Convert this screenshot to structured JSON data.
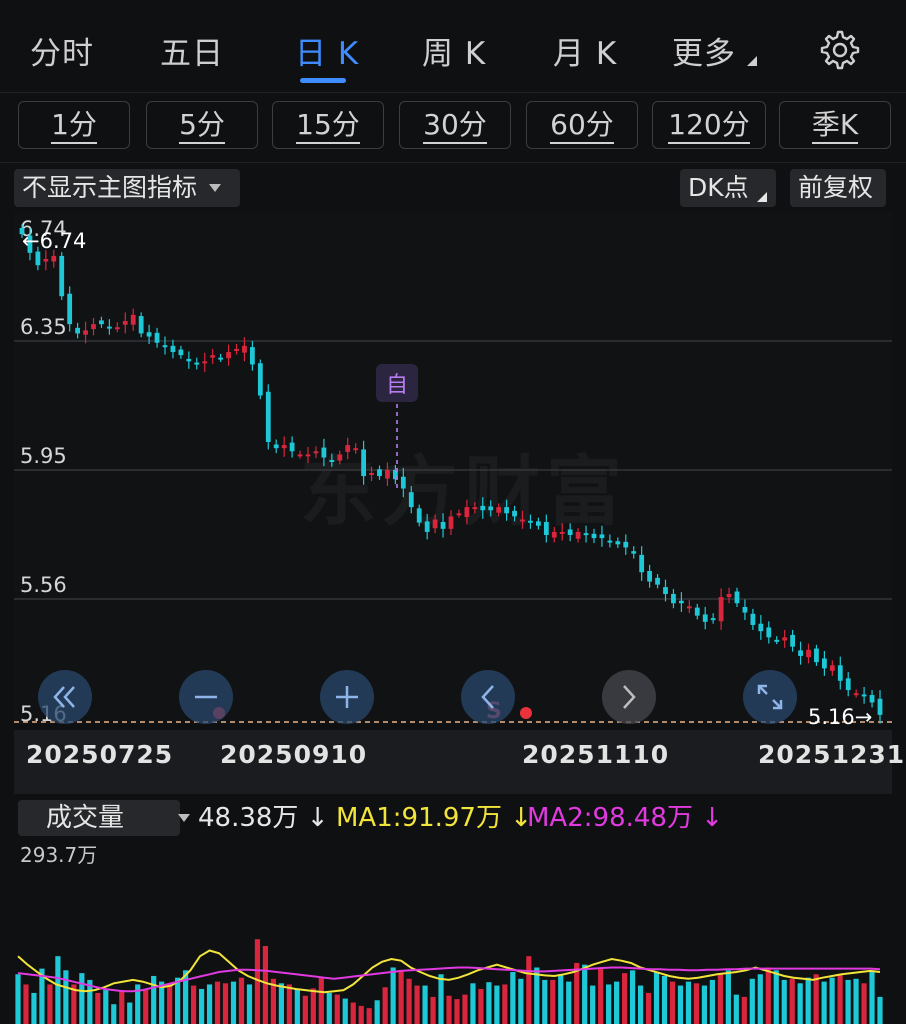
{
  "tabs": [
    {
      "label": "分时",
      "active": false
    },
    {
      "label": "五日",
      "active": false
    },
    {
      "label": "日 K",
      "active": true
    },
    {
      "label": "周 K",
      "active": false
    },
    {
      "label": "月 K",
      "active": false
    },
    {
      "label": "更多",
      "active": false
    }
  ],
  "settings_icon": "gear-icon",
  "periods": [
    "1分",
    "5分",
    "15分",
    "30分",
    "60分",
    "120分",
    "季K"
  ],
  "toolbar": {
    "indicator_select": "不显示主图指标",
    "dk_point": "DK点",
    "adjust": "前复权"
  },
  "watermark": "东方财富",
  "nav_buttons": [
    {
      "icon": "double-chevron-left-icon"
    },
    {
      "icon": "zoom-out-minus-icon"
    },
    {
      "icon": "zoom-in-plus-icon"
    },
    {
      "icon": "chevron-left-icon"
    },
    {
      "icon": "chevron-right-icon"
    },
    {
      "icon": "fullscreen-expand-icon"
    }
  ],
  "markers": {
    "self_select": "自",
    "sell": "S"
  },
  "colors": {
    "up": "#d7263d",
    "down": "#1fc8d6",
    "ma1": "#f2e43a",
    "ma2": "#e03ae0",
    "accent": "#3f8cff",
    "dash": "#e8b48a"
  },
  "chart_data": {
    "type": "candlestick",
    "price_axis": {
      "ticks": [
        "6.74",
        "6.35",
        "5.95",
        "5.56",
        "5.16"
      ],
      "ylim": [
        5.16,
        6.74
      ]
    },
    "high_label": "6.74",
    "low_label": "5.16",
    "date_labels": [
      "20250725",
      "20250910",
      "20251110",
      "20251231"
    ],
    "series": [
      {
        "name": "close",
        "values": [
          6.72,
          6.66,
          6.62,
          6.64,
          6.65,
          6.52,
          6.43,
          6.4,
          6.41,
          6.43,
          6.43,
          6.42,
          6.42,
          6.44,
          6.46,
          6.4,
          6.39,
          6.37,
          6.36,
          6.34,
          6.33,
          6.31,
          6.3,
          6.31,
          6.33,
          6.32,
          6.34,
          6.35,
          6.36,
          6.3,
          6.2,
          6.05,
          6.03,
          6.04,
          6.02,
          6.01,
          6.01,
          6.02,
          6.0,
          5.99,
          6.01,
          6.04,
          6.03,
          5.94,
          5.95,
          5.94,
          5.96,
          5.93,
          5.9,
          5.84,
          5.79,
          5.76,
          5.8,
          5.77,
          5.81,
          5.82,
          5.84,
          5.84,
          5.83,
          5.83,
          5.84,
          5.82,
          5.81,
          5.8,
          5.79,
          5.78,
          5.75,
          5.76,
          5.76,
          5.75,
          5.76,
          5.75,
          5.74,
          5.74,
          5.73,
          5.72,
          5.71,
          5.69,
          5.63,
          5.6,
          5.59,
          5.56,
          5.53,
          5.53,
          5.52,
          5.49,
          5.47,
          5.48,
          5.55,
          5.56,
          5.53,
          5.5,
          5.46,
          5.44,
          5.42,
          5.41,
          5.42,
          5.39,
          5.36,
          5.38,
          5.34,
          5.32,
          5.33,
          5.28,
          5.25,
          5.24,
          5.23,
          5.21,
          5.17
        ]
      }
    ]
  },
  "volume": {
    "indicator": "成交量",
    "current": "48.38万",
    "ma1": "MA1:91.97万",
    "ma2": "MA2:98.48万",
    "arrow": "↓",
    "axis_max": "293.7万",
    "chart_data": {
      "type": "bar",
      "ylim": [
        0,
        293.7
      ],
      "values": [
        88,
        70,
        55,
        98,
        70,
        120,
        95,
        70,
        90,
        78,
        55,
        60,
        35,
        60,
        38,
        70,
        62,
        85,
        75,
        70,
        82,
        95,
        68,
        62,
        70,
        75,
        72,
        75,
        82,
        70,
        150,
        138,
        80,
        72,
        70,
        62,
        50,
        63,
        82,
        55,
        52,
        45,
        38,
        32,
        28,
        42,
        65,
        100,
        95,
        80,
        68,
        68,
        48,
        88,
        50,
        44,
        52,
        72,
        62,
        74,
        68,
        70,
        92,
        80,
        120,
        100,
        78,
        78,
        88,
        75,
        108,
        105,
        68,
        100,
        70,
        75,
        90,
        95,
        68,
        55,
        92,
        85,
        75,
        68,
        75,
        72,
        68,
        78,
        88,
        95,
        52,
        48,
        80,
        88,
        100,
        95,
        78,
        80,
        72,
        82,
        88,
        75,
        82,
        88,
        78,
        80,
        72,
        92,
        48
      ],
      "ma1": [
        120,
        105,
        92,
        80,
        70,
        65,
        60,
        58,
        60,
        65,
        72,
        75,
        78,
        75,
        70,
        65,
        68,
        78,
        95,
        120,
        130,
        125,
        110,
        95,
        85,
        78,
        72,
        68,
        65,
        62,
        60,
        58,
        56,
        58,
        60,
        70,
        85,
        100,
        110,
        115,
        112,
        100,
        92,
        85,
        80,
        78,
        82,
        88,
        95,
        100,
        105,
        100,
        95,
        90,
        88,
        86,
        85,
        88,
        92,
        98,
        105,
        110,
        115,
        112,
        108,
        100,
        95,
        90,
        85,
        82,
        80,
        82,
        85,
        88,
        90,
        92,
        95,
        100,
        95,
        90,
        85,
        82,
        80,
        78,
        82,
        85,
        88,
        90,
        92,
        94,
        92
      ],
      "ma2": [
        90,
        88,
        86,
        84,
        82,
        78,
        74,
        70,
        66,
        62,
        60,
        58,
        58,
        60,
        64,
        68,
        72,
        76,
        80,
        84,
        88,
        92,
        94,
        96,
        96,
        95,
        94,
        92,
        90,
        88,
        86,
        84,
        82,
        80,
        82,
        84,
        86,
        88,
        90,
        92,
        94,
        95,
        96,
        97,
        98,
        99,
        100,
        100,
        99,
        98,
        97,
        96,
        95,
        94,
        93,
        93,
        94,
        95,
        96,
        97,
        98,
        99,
        100,
        100,
        99,
        98,
        97,
        97,
        96,
        96,
        95,
        95,
        96,
        96,
        97,
        97,
        98,
        98,
        98,
        98,
        98,
        98,
        98,
        98,
        98,
        98,
        98,
        98,
        98,
        98,
        97
      ]
    }
  }
}
